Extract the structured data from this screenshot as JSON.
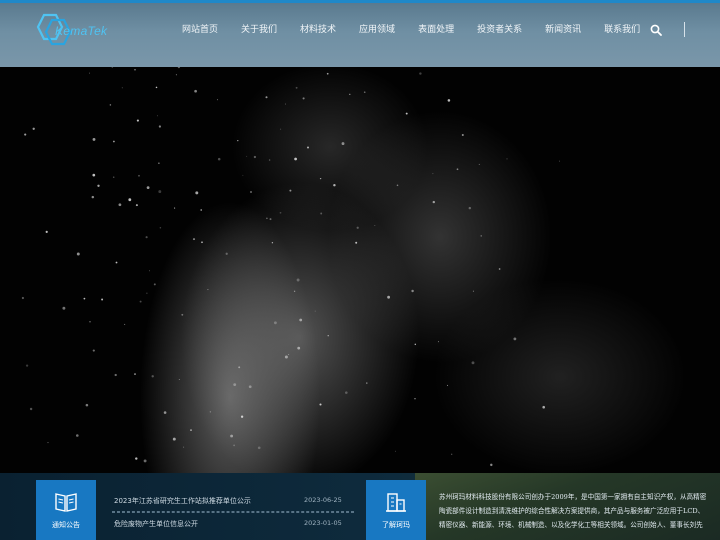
{
  "header": {
    "logo_text": "KemaTek",
    "nav": [
      "网站首页",
      "关于我们",
      "材料技术",
      "应用领域",
      "表面处理",
      "投资者关系",
      "新闻资讯",
      "联系我们"
    ]
  },
  "notice": {
    "label": "通知公告",
    "items": [
      {
        "title": "2023年江苏省研究生工作站拟推荐单位公示",
        "date": "2023-06-25"
      },
      {
        "title": "危险废物产生单位信息公开",
        "date": "2023-01-05"
      }
    ]
  },
  "about": {
    "label": "了解珂玛",
    "lines": [
      "苏州珂玛材料科技股份有限公司创办于2009年，是中国第一家拥有自主知识产权，从高精密",
      "陶瓷部件设计制造到清洗维护的综合性解决方案提供商，其产品与服务被广泛应用于LCD、",
      "精密仪器、新能源、环境、机械制造、以及化学化工等相关领域。公司创始人、董事长刘先"
    ]
  },
  "colors": {
    "accent": "#1878c2",
    "header_top": "#1f88c9",
    "logo": "#4fc3f2"
  }
}
